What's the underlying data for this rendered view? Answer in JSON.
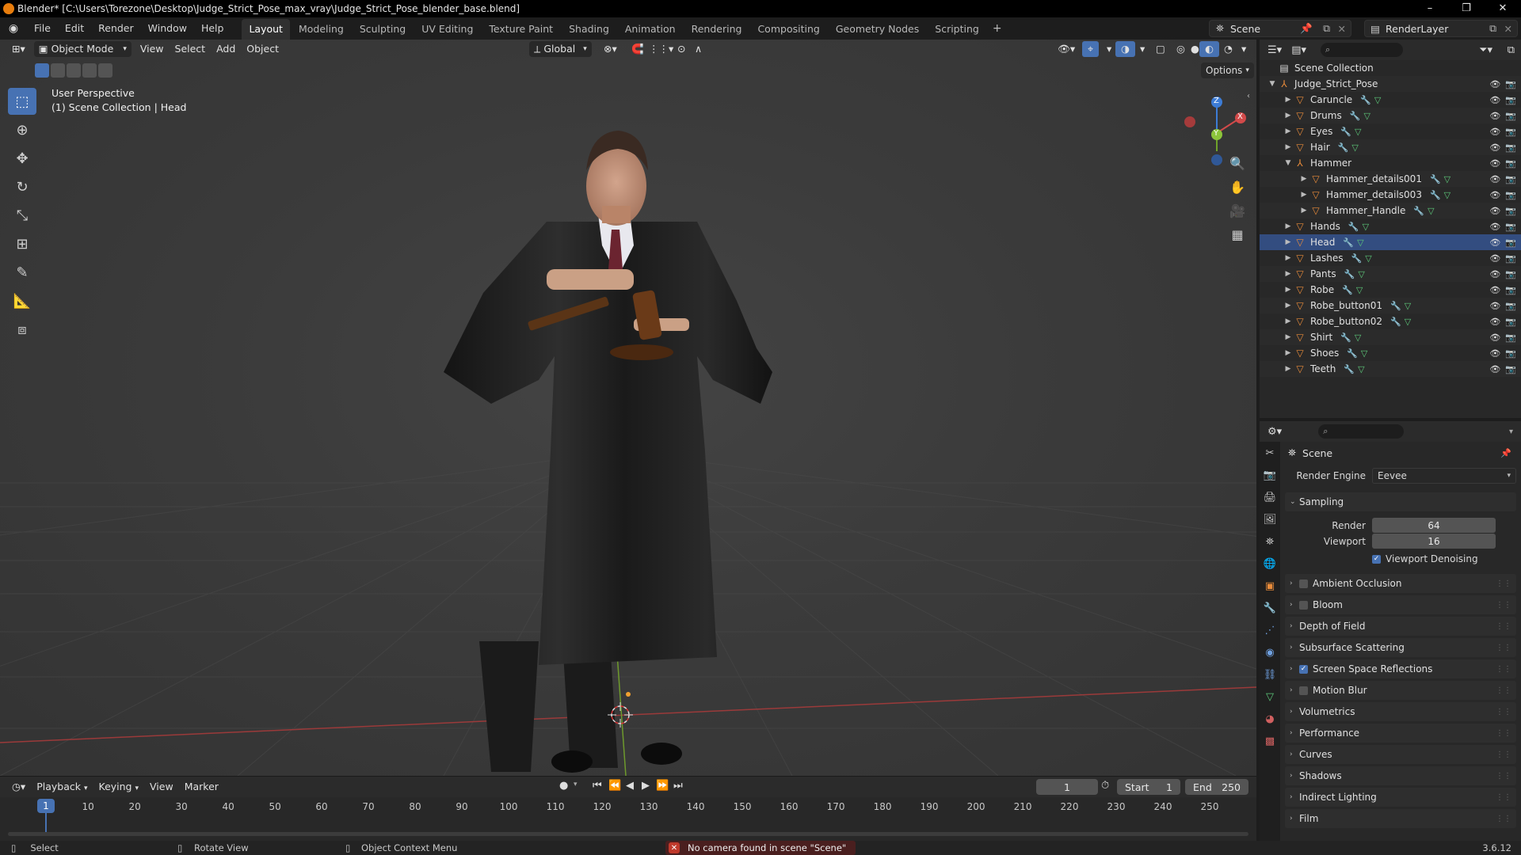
{
  "window": {
    "title": "Blender* [C:\\Users\\Torezone\\Desktop\\Judge_Strict_Pose_max_vray\\Judge_Strict_Pose_blender_base.blend]",
    "minimize": "–",
    "maximize": "❐",
    "close": "✕"
  },
  "menu": [
    "File",
    "Edit",
    "Render",
    "Window",
    "Help"
  ],
  "workspaces": [
    "Layout",
    "Modeling",
    "Sculpting",
    "UV Editing",
    "Texture Paint",
    "Shading",
    "Animation",
    "Rendering",
    "Compositing",
    "Geometry Nodes",
    "Scripting"
  ],
  "active_workspace": "Layout",
  "add_workspace": "+",
  "scene": {
    "name": "Scene",
    "view_layer": "RenderLayer"
  },
  "viewport": {
    "mode": "Object Mode",
    "menus": [
      "View",
      "Select",
      "Add",
      "Object"
    ],
    "transform_orientation": "Global",
    "options_label": "Options",
    "info_line1": "User Perspective",
    "info_line2": "(1) Scene Collection | Head",
    "gizmo": {
      "x": "X",
      "y": "Y",
      "z": "Z"
    }
  },
  "outliner": {
    "root": "Scene Collection",
    "collection": "Judge_Strict_Pose",
    "items": [
      {
        "name": "Caruncle",
        "level": 1,
        "expandable": true
      },
      {
        "name": "Drums",
        "level": 1,
        "expandable": true
      },
      {
        "name": "Eyes",
        "level": 1,
        "expandable": true
      },
      {
        "name": "Hair",
        "level": 1,
        "expandable": true
      },
      {
        "name": "Hammer",
        "level": 1,
        "expandable": true,
        "expanded": true,
        "empty": true
      },
      {
        "name": "Hammer_details001",
        "level": 2,
        "expandable": true
      },
      {
        "name": "Hammer_details003",
        "level": 2,
        "expandable": true
      },
      {
        "name": "Hammer_Handle",
        "level": 2,
        "expandable": true
      },
      {
        "name": "Hands",
        "level": 1,
        "expandable": true
      },
      {
        "name": "Head",
        "level": 1,
        "expandable": true,
        "active": true
      },
      {
        "name": "Lashes",
        "level": 1,
        "expandable": true
      },
      {
        "name": "Pants",
        "level": 1,
        "expandable": true
      },
      {
        "name": "Robe",
        "level": 1,
        "expandable": true
      },
      {
        "name": "Robe_button01",
        "level": 1,
        "expandable": true
      },
      {
        "name": "Robe_button02",
        "level": 1,
        "expandable": true
      },
      {
        "name": "Shirt",
        "level": 1,
        "expandable": true
      },
      {
        "name": "Shoes",
        "level": 1,
        "expandable": true
      },
      {
        "name": "Teeth",
        "level": 1,
        "expandable": true
      }
    ]
  },
  "properties": {
    "context": "Scene",
    "render_engine_label": "Render Engine",
    "render_engine": "Eevee",
    "sampling": {
      "label": "Sampling",
      "render_label": "Render",
      "render": "64",
      "viewport_label": "Viewport",
      "viewport": "16",
      "denoise_label": "Viewport Denoising",
      "denoise": true
    },
    "panels": [
      {
        "label": "Ambient Occlusion",
        "checkbox": true,
        "checked": false
      },
      {
        "label": "Bloom",
        "checkbox": true,
        "checked": false
      },
      {
        "label": "Depth of Field",
        "checkbox": false
      },
      {
        "label": "Subsurface Scattering",
        "checkbox": false
      },
      {
        "label": "Screen Space Reflections",
        "checkbox": true,
        "checked": true
      },
      {
        "label": "Motion Blur",
        "checkbox": true,
        "checked": false
      },
      {
        "label": "Volumetrics",
        "checkbox": false
      },
      {
        "label": "Performance",
        "checkbox": false
      },
      {
        "label": "Curves",
        "checkbox": false
      },
      {
        "label": "Shadows",
        "checkbox": false
      },
      {
        "label": "Indirect Lighting",
        "checkbox": false
      },
      {
        "label": "Film",
        "checkbox": false
      }
    ]
  },
  "timeline": {
    "menus": [
      "Playback",
      "Keying",
      "View",
      "Marker"
    ],
    "current_frame": "1",
    "start_label": "Start",
    "start": "1",
    "end_label": "End",
    "end": "250",
    "ticks": [
      10,
      20,
      30,
      40,
      50,
      60,
      70,
      80,
      90,
      100,
      110,
      120,
      130,
      140,
      150,
      160,
      170,
      180,
      190,
      200,
      210,
      220,
      230,
      240,
      250
    ],
    "tick_min": 1,
    "tick_max": 250,
    "playhead_label": "1"
  },
  "statusbar": {
    "select": "Select",
    "rotate": "Rotate View",
    "context_menu": "Object Context Menu",
    "error": "No camera found in scene \"Scene\"",
    "version": "3.6.12"
  },
  "colors": {
    "accent": "#4772b3",
    "object": "#e88b3a",
    "modifier": "#6fa0e0",
    "mesh": "#5dc87a",
    "error": "#c0392b"
  }
}
